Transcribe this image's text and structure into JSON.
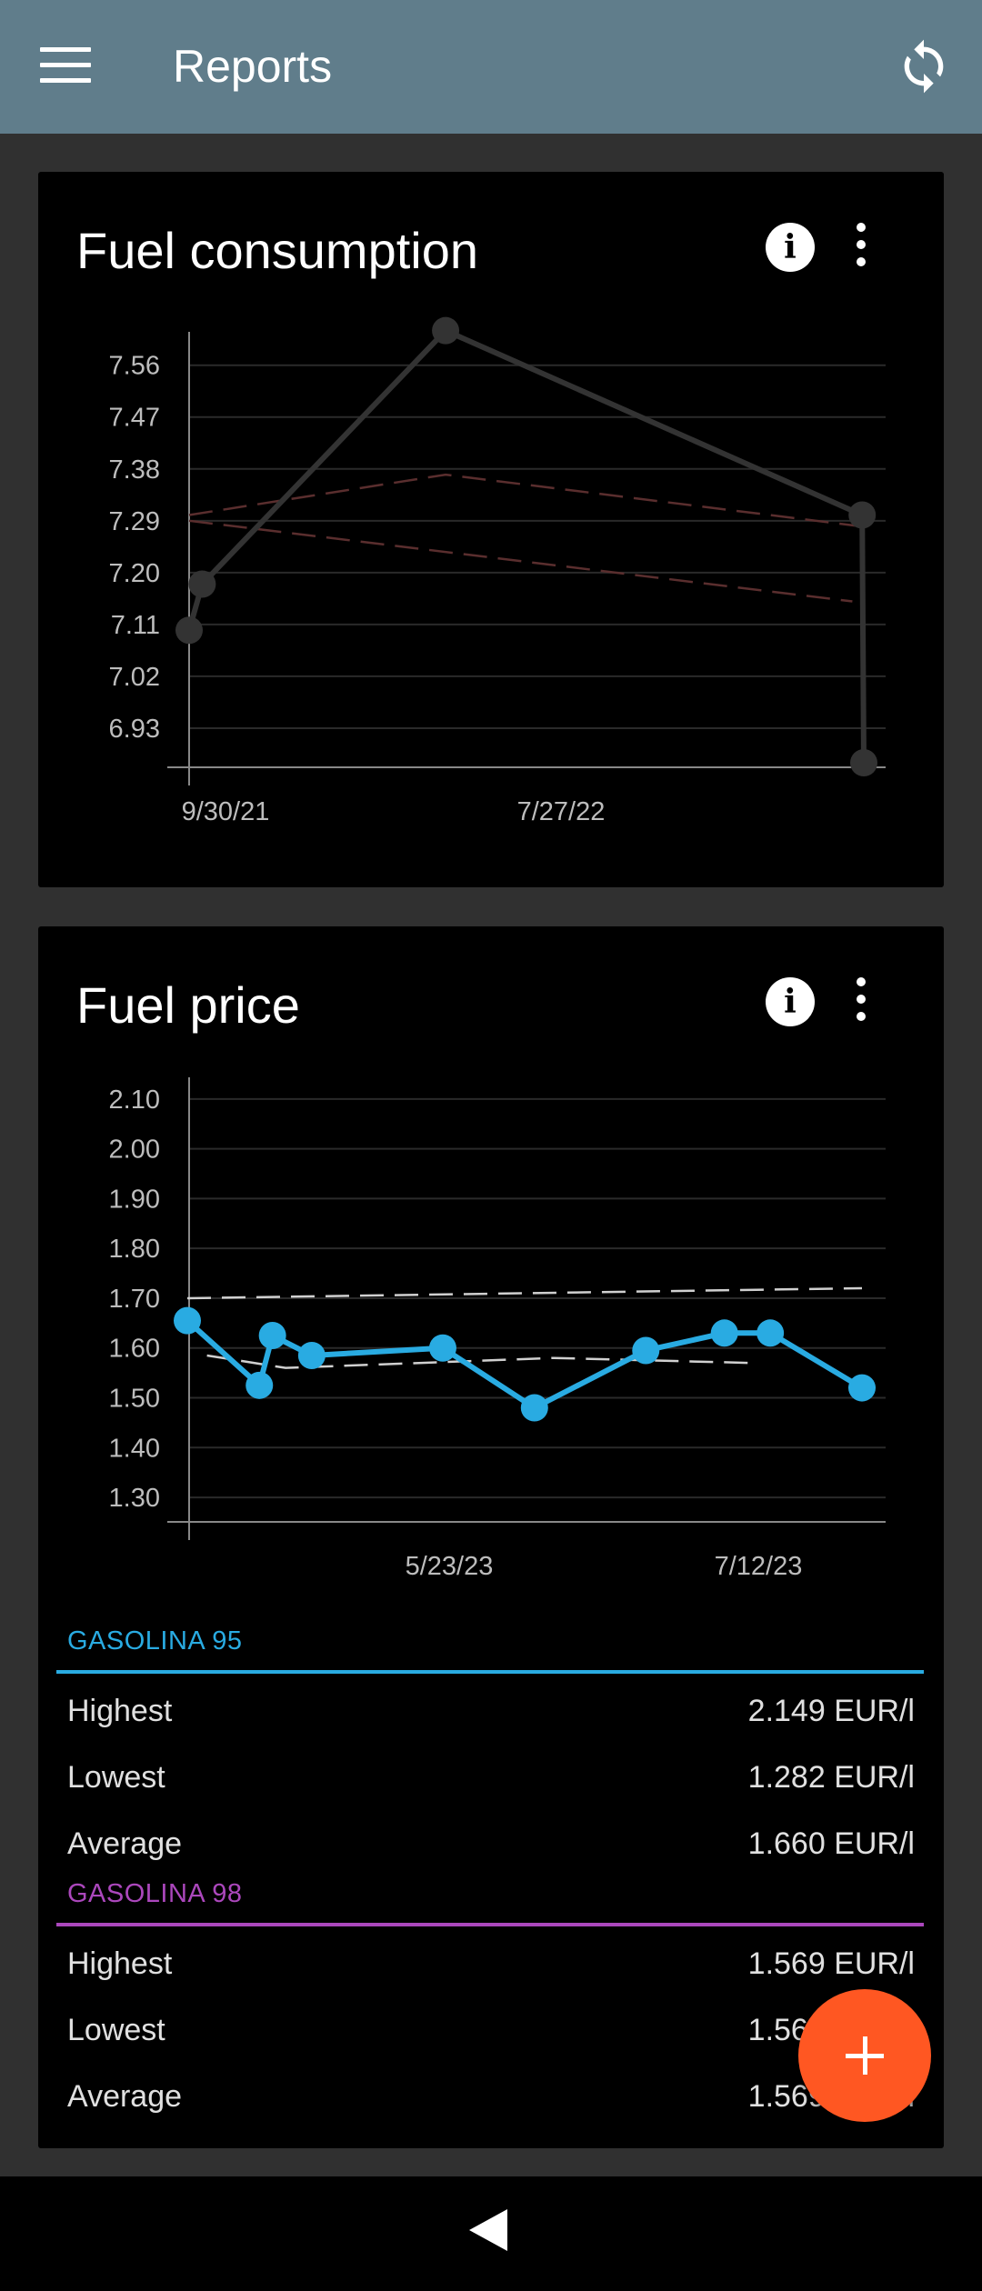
{
  "appbar": {
    "title": "Reports",
    "menu_icon": "hamburger-menu-icon",
    "sync_icon": "sync-icon"
  },
  "cards": {
    "consumption": {
      "title": "Fuel consumption",
      "info_icon": "info-icon",
      "more_icon": "more-vert-icon"
    },
    "price": {
      "title": "Fuel price",
      "info_icon": "info-icon",
      "more_icon": "more-vert-icon"
    }
  },
  "chart_data": [
    {
      "type": "line",
      "title": "Fuel consumption",
      "x_ticks": [
        "9/30/21",
        "7/27/22"
      ],
      "y_ticks": [
        "7.56",
        "7.47",
        "7.38",
        "7.29",
        "7.20",
        "7.11",
        "7.02",
        "6.93"
      ],
      "ylim": [
        6.87,
        7.64
      ],
      "series": [
        {
          "color": "#333333",
          "x": [
            "2021-09-30",
            "2021-10-08",
            "2022-03-06",
            "2022-11-16",
            "2022-11-17"
          ],
          "values": [
            7.1,
            7.18,
            7.62,
            7.3,
            6.87
          ]
        }
      ],
      "trend_lines": [
        {
          "color": "#5a2e2e",
          "x": [
            "2021-09-30",
            "2022-03-06",
            "2022-11-16"
          ],
          "values": [
            7.3,
            7.37,
            7.28
          ]
        },
        {
          "color": "#5a2e2e",
          "x": [
            "2021-09-30",
            "2022-11-10"
          ],
          "values": [
            7.29,
            7.15
          ]
        }
      ],
      "grid": true
    },
    {
      "type": "line",
      "title": "Fuel price",
      "x_ticks": [
        "5/23/23",
        "7/12/23"
      ],
      "y_ticks": [
        "2.10",
        "2.00",
        "1.90",
        "1.80",
        "1.70",
        "1.60",
        "1.50",
        "1.40",
        "1.30"
      ],
      "ylim": [
        1.26,
        2.18
      ],
      "series": [
        {
          "name": "GASOLINA 95",
          "color": "#29abe2",
          "x": [
            "2023-04-15",
            "2023-04-26",
            "2023-04-28",
            "2023-05-04",
            "2023-05-24",
            "2023-06-07",
            "2023-06-24",
            "2023-07-06",
            "2023-07-13",
            "2023-07-27"
          ],
          "values": [
            1.655,
            1.525,
            1.625,
            1.585,
            1.6,
            1.48,
            1.595,
            1.63,
            1.63,
            1.52
          ]
        }
      ],
      "trend_lines": [
        {
          "color": "#d0d0d0",
          "x": [
            "2023-04-15",
            "2023-07-27"
          ],
          "values": [
            1.7,
            1.72
          ]
        },
        {
          "color": "#d0d0d0",
          "x": [
            "2023-04-18",
            "2023-04-30",
            "2023-06-10",
            "2023-07-10"
          ],
          "values": [
            1.585,
            1.56,
            1.58,
            1.57
          ]
        }
      ],
      "grid": true
    }
  ],
  "stats": {
    "groups": [
      {
        "name": "GASOLINA 95",
        "color": "#29abe2",
        "rows": [
          {
            "label": "Highest",
            "value": "2.149 EUR/l"
          },
          {
            "label": "Lowest",
            "value": "1.282 EUR/l"
          },
          {
            "label": "Average",
            "value": "1.660 EUR/l"
          }
        ]
      },
      {
        "name": "GASOLINA 98",
        "color": "#ab47bc",
        "rows": [
          {
            "label": "Highest",
            "value": "1.569 EUR/l"
          },
          {
            "label": "Lowest",
            "value": "1.569 EUR/l"
          },
          {
            "label": "Average",
            "value": "1.569 EUR/l"
          }
        ]
      }
    ]
  },
  "fab_icon": "add-icon",
  "navbar": {
    "back_icon": "back-triangle-icon"
  }
}
